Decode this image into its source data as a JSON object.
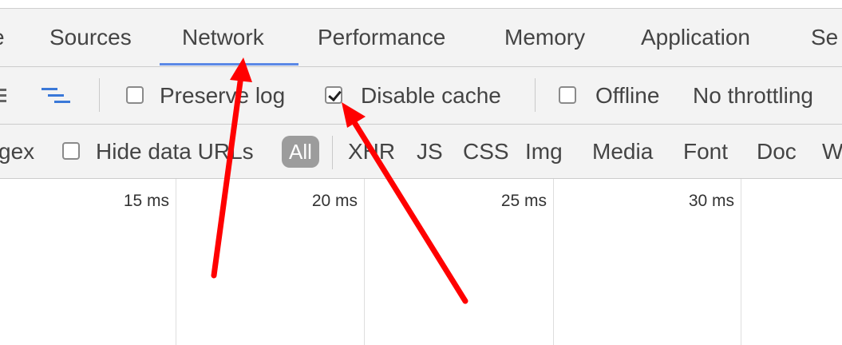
{
  "tabs": [
    {
      "label": "e"
    },
    {
      "label": "Sources"
    },
    {
      "label": "Network"
    },
    {
      "label": "Performance"
    },
    {
      "label": "Memory"
    },
    {
      "label": "Application"
    },
    {
      "label": "Se"
    }
  ],
  "toolbar": {
    "preserve_log": {
      "label": "Preserve log",
      "checked": false
    },
    "disable_cache": {
      "label": "Disable cache",
      "checked": true
    },
    "offline": {
      "label": "Offline",
      "checked": false
    },
    "throttling": "No throttling"
  },
  "filters": {
    "regex_partial": "gex",
    "hide_data_urls": {
      "label": "Hide data URLs",
      "checked": false
    },
    "types": [
      "All",
      "XHR",
      "JS",
      "CSS",
      "Img",
      "Media",
      "Font",
      "Doc",
      "W"
    ]
  },
  "timeline": {
    "ticks": [
      "15 ms",
      "20 ms",
      "25 ms",
      "30 ms"
    ]
  },
  "colors": {
    "active_tab_underline": "#5b88e6",
    "annotation_arrow": "#ff0000"
  }
}
